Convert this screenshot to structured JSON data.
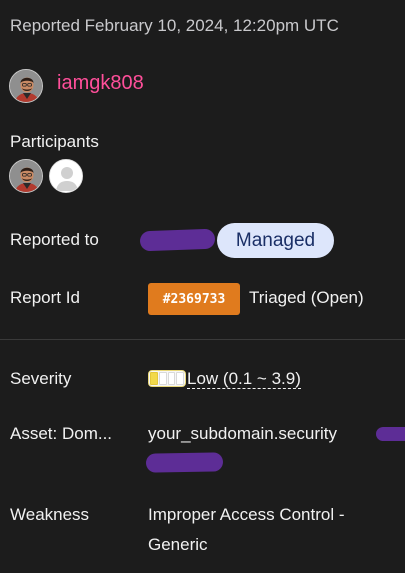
{
  "report": {
    "timestamp": "Reported February 10, 2024, 12:20pm UTC",
    "reporter": "iamgk808"
  },
  "participants": {
    "label": "Participants"
  },
  "fields": {
    "reported_to_label": "Reported to",
    "managed_badge": "Managed",
    "report_id_label": "Report Id",
    "report_id": "#2369733",
    "report_state": "Triaged (Open)",
    "severity_label": "Severity",
    "severity_value": "Low (0.1 ~ 3.9)",
    "severity_level": 1,
    "severity_max": 4,
    "asset_label": "Asset: Dom...",
    "asset_value": "your_subdomain.security",
    "weakness_label": "Weakness",
    "weakness_line1": "Improper Access Control -",
    "weakness_line2": "Generic"
  },
  "colors": {
    "background": "#1c1c1c",
    "reporter_link": "#ff4f9a",
    "managed_badge_bg": "#dde6fb",
    "report_id_badge_bg": "#e07b1e",
    "redaction": "#5d2d96",
    "severity_low": "#f2d94a"
  },
  "icons": {
    "reporter_avatar": "user-photo-avatar",
    "participant_avatar_2": "default-user-avatar"
  }
}
